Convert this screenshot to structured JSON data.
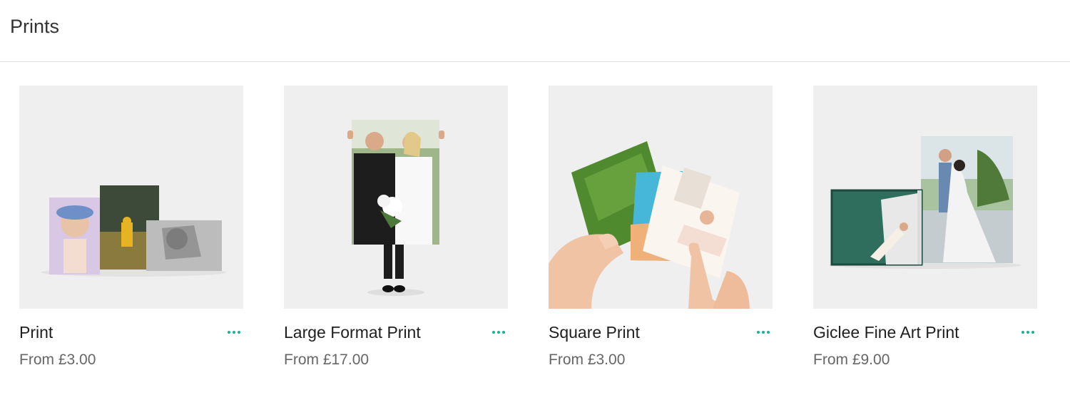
{
  "header": {
    "title": "Prints"
  },
  "colors": {
    "accent": "#19b394",
    "thumb_background": "#efefef"
  },
  "products": [
    {
      "name": "Print",
      "price": "From £3.00",
      "more_icon": "more-horizontal-icon"
    },
    {
      "name": "Large Format Print",
      "price": "From £17.00",
      "more_icon": "more-horizontal-icon"
    },
    {
      "name": "Square Print",
      "price": "From £3.00",
      "more_icon": "more-horizontal-icon"
    },
    {
      "name": "Giclee Fine Art Print",
      "price": "From £9.00",
      "more_icon": "more-horizontal-icon"
    }
  ]
}
